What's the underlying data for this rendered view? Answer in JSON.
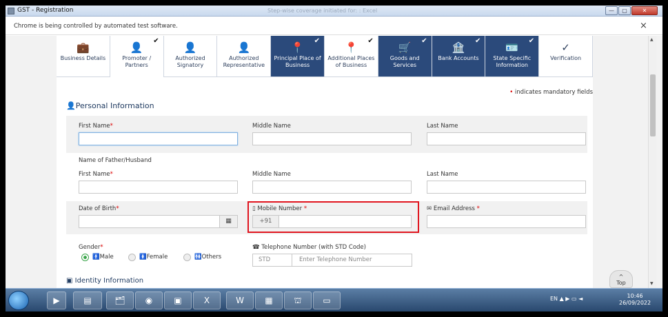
{
  "window": {
    "title": "GST - Registration",
    "faded_title": "Step-wise coverage initiated for: : Excel",
    "min": "—",
    "max": "▢",
    "close": "✕"
  },
  "infobar": {
    "message": "Chrome is being controlled by automated test software.",
    "close": "×"
  },
  "steps": [
    {
      "label": "Business Details",
      "icon": "briefcase-icon",
      "glyph": "💼",
      "state": "normal",
      "checked": false
    },
    {
      "label": "Promoter / Partners",
      "icon": "person-icon",
      "glyph": "👤",
      "state": "active",
      "checked": true
    },
    {
      "label": "Authorized Signatory",
      "icon": "person-check-icon",
      "glyph": "👤",
      "state": "normal",
      "checked": false
    },
    {
      "label": "Authorized Representative",
      "icon": "person-check-icon",
      "glyph": "👤",
      "state": "normal",
      "checked": false
    },
    {
      "label": "Principal Place of Business",
      "icon": "location-pin-icon",
      "glyph": "📍",
      "state": "done",
      "checked": true
    },
    {
      "label": "Additional Places of Business",
      "icon": "location-pins-icon",
      "glyph": "📍",
      "state": "normal",
      "checked": true
    },
    {
      "label": "Goods and Services",
      "icon": "goods-icon",
      "glyph": "🛒",
      "state": "done",
      "checked": true
    },
    {
      "label": "Bank Accounts",
      "icon": "bank-icon",
      "glyph": "🏦",
      "state": "done",
      "checked": true
    },
    {
      "label": "State Specific Information",
      "icon": "id-card-icon",
      "glyph": "🪪",
      "state": "done",
      "checked": true
    },
    {
      "label": "Verification",
      "icon": "check-circle-icon",
      "glyph": "✓",
      "state": "normal",
      "checked": false
    }
  ],
  "step_check": "✔",
  "form": {
    "mandatory_star": "•",
    "mandatory_note": "indicates mandatory fields",
    "section_title": "Personal Information",
    "first_name_label": "First Name",
    "middle_name_label": "Middle Name",
    "last_name_label": "Last Name",
    "father_heading": "Name of Father/Husband",
    "father_first_label": "First Name",
    "father_middle_label": "Middle Name",
    "father_last_label": "Last Name",
    "dob_label": "Date of Birth",
    "calendar_glyph": "▦",
    "mobile_label": "Mobile Number",
    "mobile_prefix": "+91",
    "email_label": "Email Address",
    "gender_label": "Gender",
    "gender_options": [
      "Male",
      "Female",
      "Others"
    ],
    "telephone_label": "Telephone Number (with STD Code)",
    "std_placeholder": "STD",
    "telephone_placeholder": "Enter Telephone Number",
    "required_star": "*",
    "identity_title": "Identity Information"
  },
  "top_button": {
    "arrow": "^",
    "label": "Top"
  },
  "taskbar": {
    "tray": "EN  ▲  ▶  ▭  ◄",
    "time": "10:46",
    "date": "26/09/2022"
  }
}
